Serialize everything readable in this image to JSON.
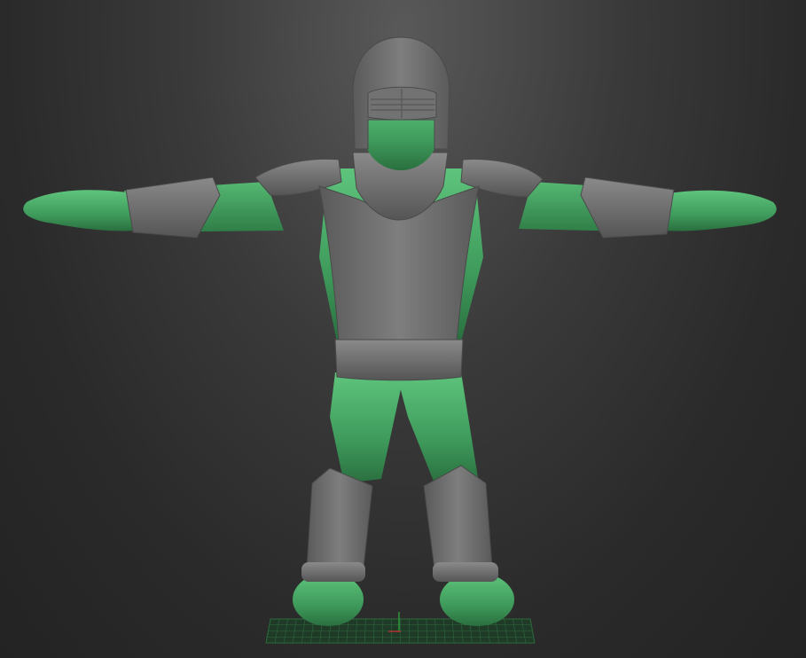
{
  "scene": {
    "background_top": "#595959",
    "background_bottom": "#232323",
    "model": {
      "skin_color": "#3f9b5c",
      "armor_color": "#6e6e6e",
      "pose": "T-pose",
      "parts": [
        "helmet",
        "visor",
        "gorget",
        "pauldron-left",
        "pauldron-right",
        "breastplate",
        "belt",
        "bracer-left",
        "bracer-right",
        "greave-left",
        "greave-right",
        "hand-left",
        "hand-right",
        "boot-left",
        "boot-right"
      ]
    },
    "floor_grid": {
      "color": "#2c6a3c",
      "axis_x_color": "#b03030",
      "axis_y_color": "#30b040"
    }
  }
}
